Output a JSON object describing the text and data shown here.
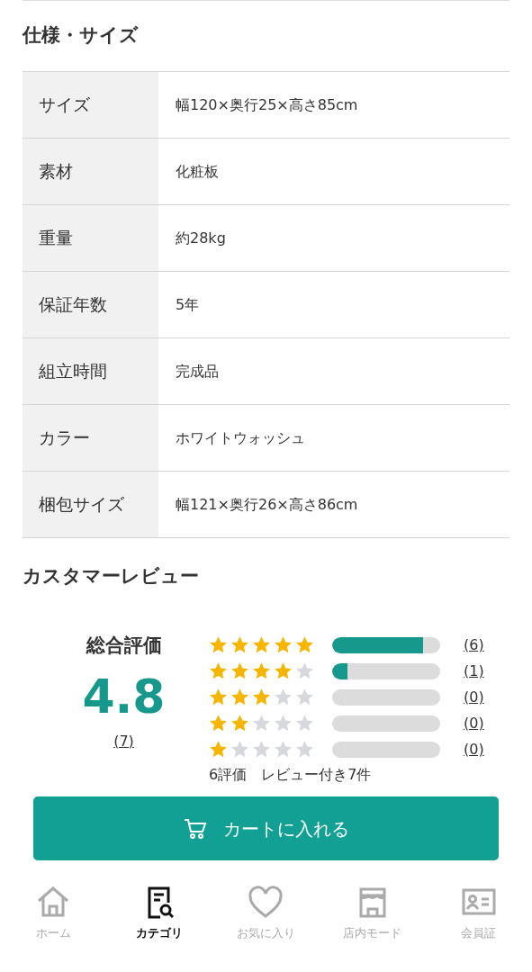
{
  "specs": {
    "title": "仕様・サイズ",
    "rows": [
      {
        "label": "サイズ",
        "value": "幅120×奥行25×高さ85cm"
      },
      {
        "label": "素材",
        "value": "化粧板"
      },
      {
        "label": "重量",
        "value": "約28kg"
      },
      {
        "label": "保証年数",
        "value": "5年"
      },
      {
        "label": "組立時間",
        "value": "完成品"
      },
      {
        "label": "カラー",
        "value": "ホワイトウォッシュ"
      },
      {
        "label": "梱包サイズ",
        "value": "幅121×奥行26×高さ86cm"
      }
    ]
  },
  "reviews": {
    "title": "カスタマーレビュー",
    "overall_label": "総合評価",
    "score": "4.8",
    "count": "(7)",
    "rows": [
      {
        "stars": 5,
        "level": 0.84,
        "count": "(6)"
      },
      {
        "stars": 4,
        "level": 0.14,
        "count": "(1)"
      },
      {
        "stars": 3,
        "count": "(0)"
      },
      {
        "stars": 2,
        "count": "(0)"
      },
      {
        "stars": 1,
        "count": "(0)"
      }
    ],
    "summary": "6評価　レビュー付き7件"
  },
  "cart_button": {
    "label": "カートに入れる"
  },
  "bottom_nav": [
    {
      "label": "ホーム",
      "selected": false
    },
    {
      "label": "カテゴリ",
      "selected": true
    },
    {
      "label": "お気に入り",
      "selected": false
    },
    {
      "label": "店内モード",
      "selected": false
    },
    {
      "label": "会員証",
      "selected": false
    }
  ]
}
